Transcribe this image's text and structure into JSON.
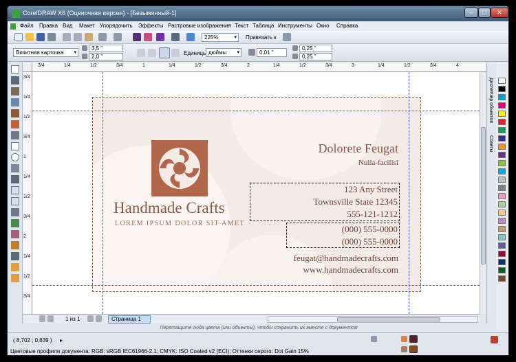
{
  "window": {
    "title": "CorelDRAW X6 (Оценочная версия) - [Безымянный-1]",
    "min_glyph": "–",
    "max_glyph": "□",
    "close_glyph": "✕"
  },
  "menu": [
    "Файл",
    "Правка",
    "Вид",
    "Макет",
    "Упорядочить",
    "Эффекты",
    "Растровые изображения",
    "Текст",
    "Таблица",
    "Инструменты",
    "Окно",
    "Справка"
  ],
  "toolbar": {
    "zoom": "225%",
    "snap_label": "Привязать к"
  },
  "property_bar": {
    "preset": "Визитная карточка",
    "width": "3,5 \"",
    "height": "2,0 \"",
    "units_label": "Единицы:",
    "units": "дюймы",
    "nudge": "0,01 \"",
    "dup_x": "0,25 \"",
    "dup_y": "0,25 \""
  },
  "ruler": {
    "h_ticks": [
      "3/4",
      "1/4",
      "1/2",
      "3/4",
      "1",
      "1/4",
      "1/2",
      "3/4",
      "2",
      "1/4",
      "1/2",
      "3/4",
      "3",
      "1/4",
      "1/2",
      "3/4",
      "4"
    ],
    "v_ticks": [
      "3/4",
      "1/4",
      "1/2",
      "3/4",
      "1",
      "1/4",
      "1/2",
      "3/4",
      "2",
      "1/4",
      "1/2",
      "3/4"
    ]
  },
  "card": {
    "brand": "Handmade Crafts",
    "tagline": "LOREM IPSUM DOLOR SIT AMET",
    "name": "Dolorete Feugat",
    "position": "Nulla-facilisi",
    "street": "123 Any Street",
    "city": "Townsville State 12345",
    "phone1": "555-121-1212",
    "phone2": "(000) 555-0000",
    "phone3": "(000) 555-0000",
    "email": "feugat@handmadecrafts.com",
    "website": "www.handmadecrafts.com",
    "colors": {
      "background": "#f4ebe6",
      "accent": "#b0674a",
      "text": "#6a4038"
    }
  },
  "docker": {
    "tab1": "Диспетчер объектов",
    "tab2": "Советы"
  },
  "palette": [
    "#ffffff",
    "#000000",
    "#00a0e0",
    "#e0007a",
    "#fff200",
    "#ed1c24",
    "#00a651",
    "#2e3192",
    "#f7941d",
    "#662d91",
    "#8dc63f",
    "#00aeef",
    "#c0c0c0",
    "#808080",
    "#f49ac1",
    "#a3d39c",
    "#fdc689",
    "#bd8cbf",
    "#c69c6d",
    "#7accc8",
    "#605ca8",
    "#9e0039",
    "#003471",
    "#005e20",
    "#754c24"
  ],
  "page": {
    "counter": "1 из 1",
    "tab": "Страница 1"
  },
  "hint": "Перетащите сюда цвета (или объекты), чтобы сохранить их вместе с документом",
  "status": {
    "coords": "( 8,702 ; 0,839 )",
    "profiles": "Цветовые профили документа: RGB: sRGB IEC61966-2.1; CMYK: ISO Coated v2 (ECI); Оттенки серого: Dot Gain 15%",
    "fill_color": "#5a1c2a",
    "outline_color": "#8a4a20"
  }
}
